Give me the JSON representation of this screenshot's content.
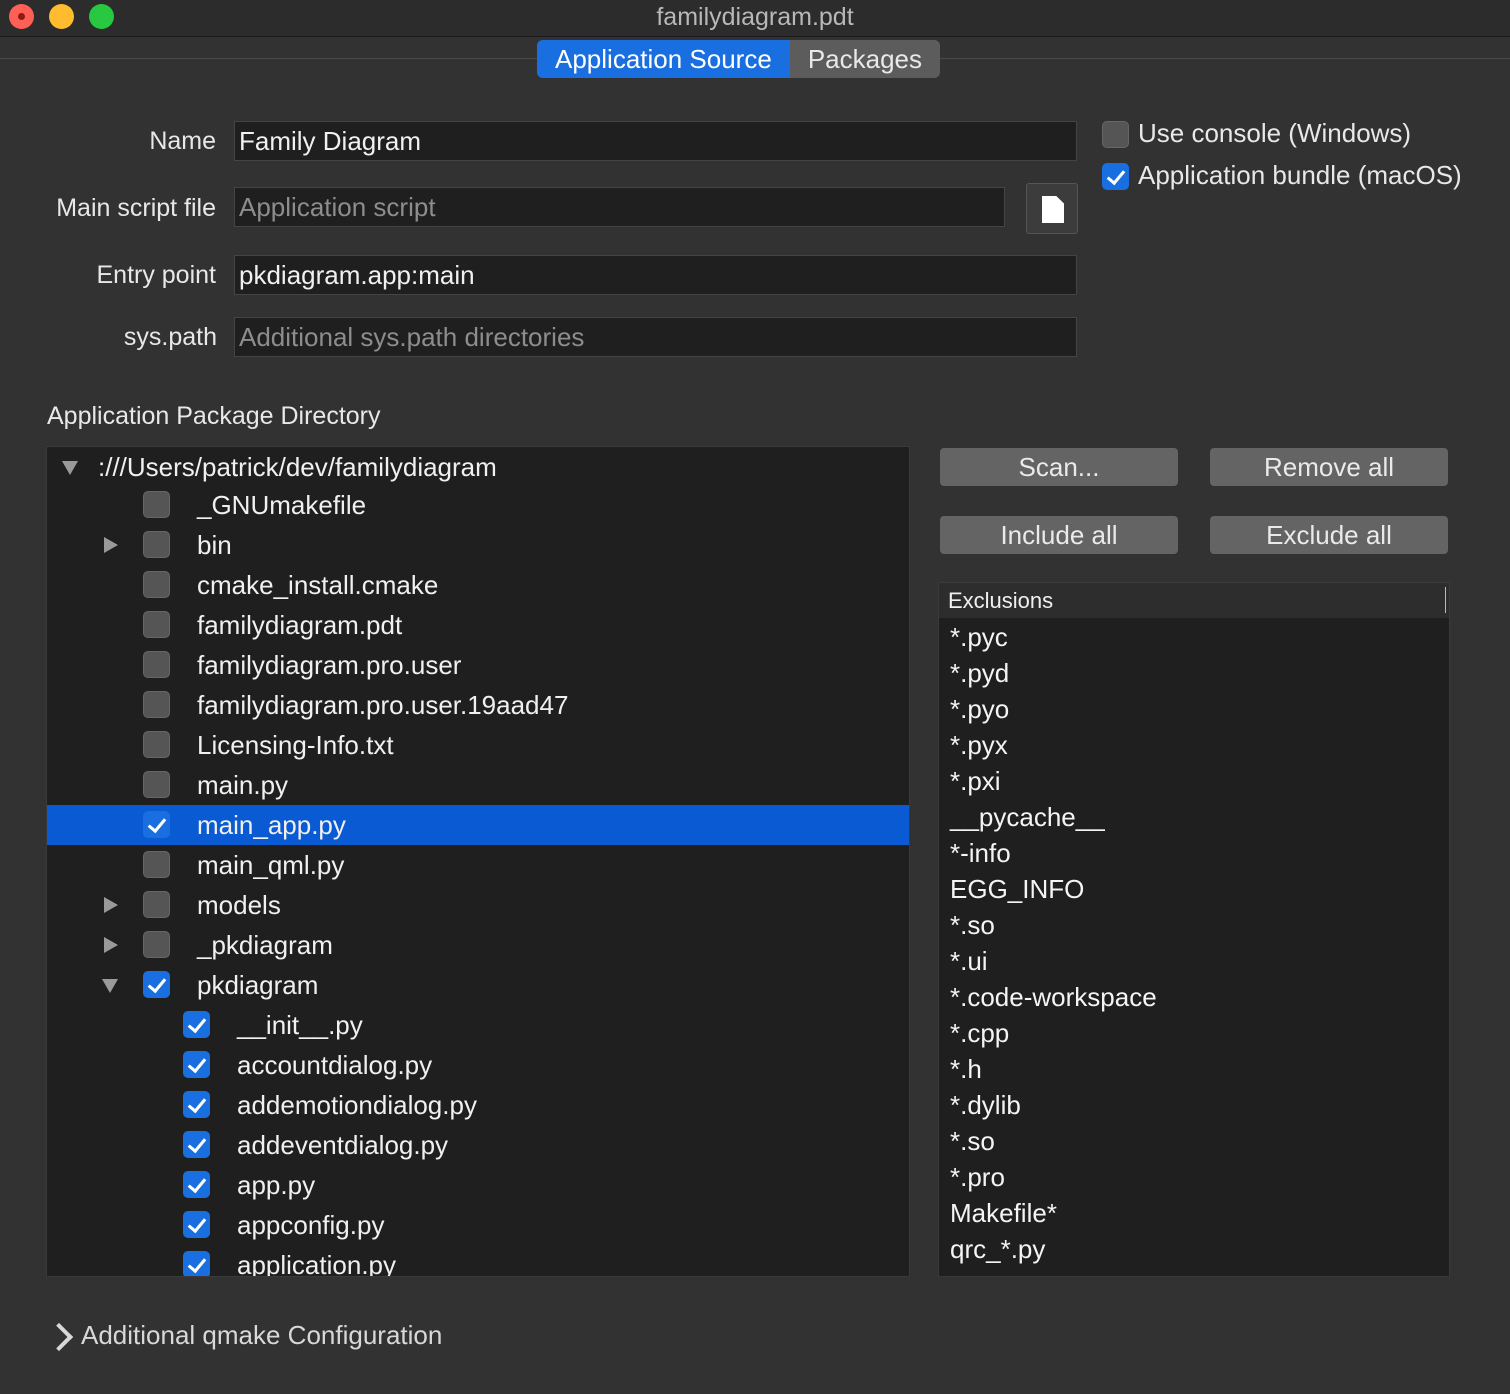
{
  "window": {
    "title": "familydiagram.pdt"
  },
  "tabs": [
    {
      "label": "Application Source",
      "active": true
    },
    {
      "label": "Packages",
      "active": false
    }
  ],
  "form": {
    "name_label": "Name",
    "name_value": "Family Diagram",
    "main_script_label": "Main script file",
    "main_script_placeholder": "Application script",
    "entry_point_label": "Entry point",
    "entry_point_value": "pkdiagram.app:main",
    "syspath_label": "sys.path",
    "syspath_placeholder": "Additional sys.path directories"
  },
  "options": {
    "use_console": {
      "label": "Use console (Windows)",
      "checked": false
    },
    "app_bundle": {
      "label": "Application bundle (macOS)",
      "checked": true
    }
  },
  "package_dir": {
    "title": "Application Package Directory",
    "root": ":///Users/patrick/dev/familydiagram",
    "rows": [
      {
        "label": "_GNUmakefile",
        "checked": false,
        "expander": "none",
        "depth": 1
      },
      {
        "label": "bin",
        "checked": false,
        "expander": "collapsed",
        "depth": 1
      },
      {
        "label": "cmake_install.cmake",
        "checked": false,
        "expander": "none",
        "depth": 1
      },
      {
        "label": "familydiagram.pdt",
        "checked": false,
        "expander": "none",
        "depth": 1
      },
      {
        "label": "familydiagram.pro.user",
        "checked": false,
        "expander": "none",
        "depth": 1
      },
      {
        "label": "familydiagram.pro.user.19aad47",
        "checked": false,
        "expander": "none",
        "depth": 1
      },
      {
        "label": "Licensing-Info.txt",
        "checked": false,
        "expander": "none",
        "depth": 1
      },
      {
        "label": "main.py",
        "checked": false,
        "expander": "none",
        "depth": 1
      },
      {
        "label": "main_app.py",
        "checked": true,
        "expander": "none",
        "depth": 1,
        "selected": true
      },
      {
        "label": "main_qml.py",
        "checked": false,
        "expander": "none",
        "depth": 1
      },
      {
        "label": "models",
        "checked": false,
        "expander": "collapsed",
        "depth": 1
      },
      {
        "label": "_pkdiagram",
        "checked": false,
        "expander": "collapsed",
        "depth": 1
      },
      {
        "label": "pkdiagram",
        "checked": true,
        "expander": "expanded",
        "depth": 1
      },
      {
        "label": "__init__.py",
        "checked": true,
        "expander": "none",
        "depth": 2
      },
      {
        "label": "accountdialog.py",
        "checked": true,
        "expander": "none",
        "depth": 2
      },
      {
        "label": "addemotiondialog.py",
        "checked": true,
        "expander": "none",
        "depth": 2
      },
      {
        "label": "addeventdialog.py",
        "checked": true,
        "expander": "none",
        "depth": 2
      },
      {
        "label": "app.py",
        "checked": true,
        "expander": "none",
        "depth": 2
      },
      {
        "label": "appconfig.py",
        "checked": true,
        "expander": "none",
        "depth": 2
      },
      {
        "label": "application.py",
        "checked": true,
        "expander": "none",
        "depth": 2
      }
    ]
  },
  "buttons": {
    "scan": "Scan...",
    "remove_all": "Remove all",
    "include_all": "Include all",
    "exclude_all": "Exclude all"
  },
  "exclusions": {
    "header": "Exclusions",
    "items": [
      "*.pyc",
      "*.pyd",
      "*.pyo",
      "*.pyx",
      "*.pxi",
      "__pycache__",
      "*-info",
      "EGG_INFO",
      "*.so",
      "*.ui",
      "*.code-workspace",
      "*.cpp",
      "*.h",
      "*.dylib",
      "*.so",
      "*.pro",
      "Makefile*",
      "qrc_*.py"
    ]
  },
  "footer": {
    "qmake_label": "Additional qmake Configuration"
  },
  "colors": {
    "accent": "#1a6fe0",
    "selection": "#0a5bd3",
    "background": "#323232"
  }
}
